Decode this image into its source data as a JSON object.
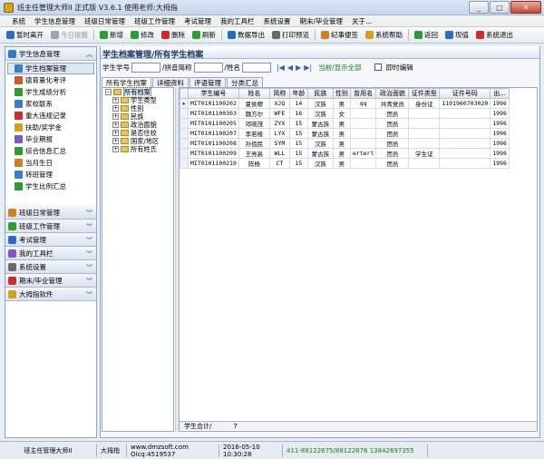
{
  "window": {
    "title": "班主任管理大师II 正式版 V3.6.1   使用老师:大拇指",
    "min": "_",
    "max": "□",
    "close": "✕"
  },
  "menu": [
    "系统",
    "学生信息管理",
    "班级日常管理",
    "班级工作管理",
    "考试管理",
    "我的工具栏",
    "系统设置",
    "期末/毕业管理",
    "关于..."
  ],
  "toolbar": [
    {
      "label": "暂时离开",
      "icon": "lock-icon",
      "color": "#2f6bc2",
      "disabled": false
    },
    {
      "label": "今日提醒",
      "icon": "bell-icon",
      "color": "#9aa5b3",
      "disabled": true
    },
    {
      "label": "新增",
      "icon": "add-icon",
      "color": "#2e9c2e",
      "disabled": false
    },
    {
      "label": "修改",
      "icon": "edit-icon",
      "color": "#2e9c2e",
      "disabled": false
    },
    {
      "label": "删除",
      "icon": "delete-icon",
      "color": "#d02a2a",
      "disabled": false
    },
    {
      "label": "刷新",
      "icon": "refresh-icon",
      "color": "#2e9c2e",
      "disabled": false
    },
    {
      "label": "数据导出",
      "icon": "export-icon",
      "color": "#1f6ebd",
      "disabled": false
    },
    {
      "label": "打印预览",
      "icon": "print-icon",
      "color": "#6a6a6a",
      "disabled": false
    },
    {
      "label": "纪事便签",
      "icon": "note-icon",
      "color": "#d0801f",
      "disabled": false
    },
    {
      "label": "系统帮助",
      "icon": "help-icon",
      "color": "#d0a21f",
      "disabled": false
    },
    {
      "label": "返回",
      "icon": "back-icon",
      "color": "#2e9c2e",
      "disabled": false
    },
    {
      "label": "现值",
      "icon": "book-icon",
      "color": "#2f6bc2",
      "disabled": false
    },
    {
      "label": "系统退出",
      "icon": "exit-icon",
      "color": "#d02a2a",
      "disabled": false
    }
  ],
  "leftpanel": {
    "sections": [
      {
        "label": "学生信息管理",
        "icon": "student-icon",
        "color": "#2f7bc9",
        "open": true,
        "items": [
          {
            "label": "学生档案管理",
            "color": "#3a7fc6",
            "selected": true
          },
          {
            "label": "德育量化考评",
            "color": "#d05a2a"
          },
          {
            "label": "学生成绩分析",
            "color": "#2e9c2e"
          },
          {
            "label": "家校联系",
            "color": "#3a7fc6"
          },
          {
            "label": "重大违规记录",
            "color": "#d02a2a"
          },
          {
            "label": "扶助/奖学金",
            "color": "#d0a21f"
          },
          {
            "label": "毕业期报",
            "color": "#7a5ac0"
          },
          {
            "label": "综合信息汇总",
            "color": "#2e9c2e"
          },
          {
            "label": "当月生日",
            "color": "#d0801f"
          },
          {
            "label": "转班管理",
            "color": "#3a7fc6"
          },
          {
            "label": "学生比例汇总",
            "color": "#2e9c2e"
          }
        ]
      },
      {
        "label": "班级日常管理",
        "icon": "calendar-icon",
        "color": "#d0801f",
        "open": false,
        "items": []
      },
      {
        "label": "班级工作管理",
        "icon": "briefcase-icon",
        "color": "#2e9c2e",
        "open": false,
        "items": []
      },
      {
        "label": "考试管理",
        "icon": "exam-icon",
        "color": "#2f6bc2",
        "open": false,
        "items": []
      },
      {
        "label": "我的工具栏",
        "icon": "tools-icon",
        "color": "#7a5ac0",
        "open": false,
        "items": []
      },
      {
        "label": "系统设置",
        "icon": "settings-icon",
        "color": "#6a6a6a",
        "open": false,
        "items": []
      },
      {
        "label": "期末/毕业管理",
        "icon": "graduation-icon",
        "color": "#d02a2a",
        "open": false,
        "items": []
      },
      {
        "label": "大拇指软件",
        "icon": "thumb-icon",
        "color": "#d0a21f",
        "open": false,
        "items": []
      }
    ]
  },
  "content": {
    "title": "学生档案管理/所有学生档案",
    "search": {
      "label_id": "学生学号",
      "label_pinyin": "/拼音简称",
      "label_name": "/姓名",
      "next": "当前/显示全部",
      "instant_edit": "即时编辑"
    },
    "tabs": [
      "所有学生档案",
      "详细资料",
      "评语管理",
      "分类汇总"
    ],
    "tree": [
      {
        "label": "所有档案",
        "level": 0,
        "selected": true
      },
      {
        "label": "学生类型",
        "level": 1
      },
      {
        "label": "性别",
        "level": 1
      },
      {
        "label": "民族",
        "level": 1
      },
      {
        "label": "政治面貌",
        "level": 1
      },
      {
        "label": "是否住校",
        "level": 1
      },
      {
        "label": "国家/地区",
        "level": 1
      },
      {
        "label": "所有姓氏",
        "level": 1
      }
    ],
    "grid": {
      "columns": [
        "学生编号",
        "姓名",
        "简称",
        "年龄",
        "民族",
        "性别",
        "曾用名",
        "政治面貌",
        "证件类型",
        "证件号码",
        "出..."
      ],
      "rows": [
        [
          "MIT0101100202",
          "夏侯穆",
          "XJQ",
          "14",
          "汉族",
          "男",
          "qq",
          "共青党员",
          "身份证",
          "1101960703020",
          "1996"
        ],
        [
          "MIT0101100303",
          "魏方尔",
          "WFE",
          "16",
          "汉族",
          "女",
          "",
          "团员",
          "",
          "",
          "1996"
        ],
        [
          "MIT0101100205",
          "邓晓茂",
          "ZYX",
          "15",
          "蒙古族",
          "男",
          "",
          "团员",
          "",
          "",
          "1996"
        ],
        [
          "MIT0101100207",
          "李若棱",
          "LYX",
          "15",
          "蒙古族",
          "男",
          "",
          "团员",
          "",
          "",
          "1996"
        ],
        [
          "MIT0101100208",
          "孙佰民",
          "SYM",
          "15",
          "汉族",
          "男",
          "",
          "团员",
          "",
          "",
          "1996"
        ],
        [
          "MIT0101100209",
          "王亮高",
          "WLL",
          "15",
          "蒙古族",
          "男",
          "ertert",
          "团员",
          "学生证",
          "",
          "1996"
        ],
        [
          "MIT0101100210",
          "陈杨",
          "CT",
          "15",
          "汉族",
          "男",
          "",
          "团员",
          "",
          "",
          "1996"
        ]
      ],
      "footer_label": "学生合计/",
      "footer_value": "7"
    }
  },
  "statusbar": {
    "app": "班主任管理大师II",
    "user": "大拇指",
    "web": "www.dmzsoft.com Oicq:4519537",
    "datetime": "2016-05-10  10:30:28",
    "phone": "411-88122675/88122676  13842697355"
  }
}
